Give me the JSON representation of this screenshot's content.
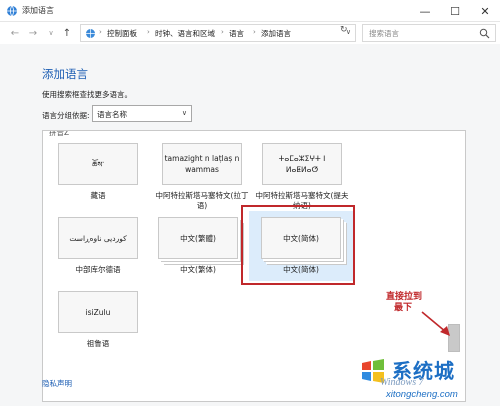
{
  "window": {
    "title": "添加语言",
    "minimize_label": "—",
    "maximize_label": "☐",
    "close_label": "✕"
  },
  "navigation": {
    "back_icon": "←",
    "forward_icon": "→",
    "recent_icon": "∨",
    "up_icon": "↑",
    "breadcrumb": [
      "控制面板",
      "时钟、语言和区域",
      "语言",
      "添加语言"
    ],
    "breadcrumb_separator": "›",
    "dropdown_icon": "∨",
    "refresh_icon": "↻",
    "search_placeholder": "搜索语言"
  },
  "main": {
    "heading": "添加语言",
    "description": "使用搜索框查找更多语言。",
    "group_label": "语言分组依据:",
    "group_value": "语言名称",
    "group_arrow": "∨",
    "section_label": "拼音Z",
    "languages": [
      {
        "card_text": "ཆོས་",
        "label": "藏语"
      },
      {
        "card_text": "tamazight n laṭlaṣ n wammas",
        "label": "中阿特拉斯塔马塞特文(拉丁语)"
      },
      {
        "card_text": "ⵜⴰⵎⴰⵣⵉⵖⵜ ⵏ ⵍⴰⵟⵍⴰⵚ",
        "label": "中阿特拉斯塔马塞特文(提夫纳语)"
      },
      {
        "card_text": "کوردیی ناوەڕاست",
        "label": "中部库尔德语"
      },
      {
        "card_text": "中文(繁體)",
        "label": "中文(繁体)"
      },
      {
        "card_text": "中文(简体)",
        "label": "中文(简体)"
      },
      {
        "card_text": "isiZulu",
        "label": "祖鲁语"
      }
    ],
    "privacy_link": "隐私声明"
  },
  "annotation": {
    "line1": "直接拉到",
    "line2": "最下"
  },
  "watermark": {
    "brand": "系统城",
    "os": "Windows 7",
    "url": "xitongcheng.com"
  },
  "colors": {
    "heading": "#1e5fb4",
    "highlight_frame": "#c0282b",
    "selected_bg": "#dcecfb"
  }
}
